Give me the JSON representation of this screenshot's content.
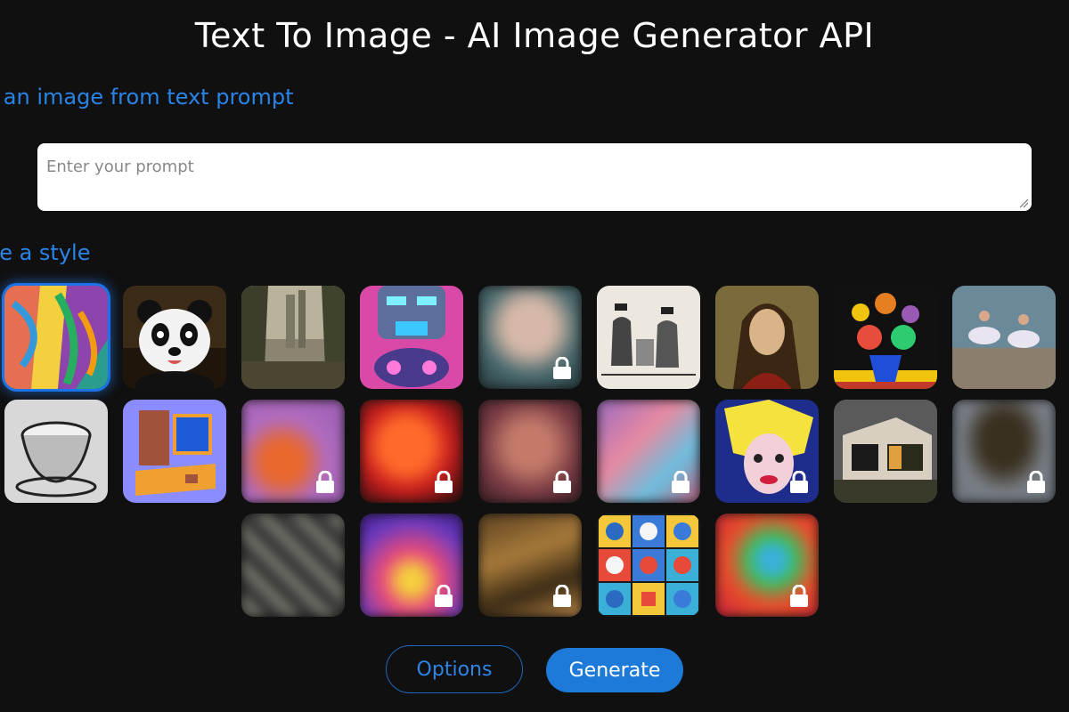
{
  "header": {
    "title": "Text To Image - AI Image Generator API",
    "subtitle": "te an image from text prompt"
  },
  "prompt": {
    "placeholder": "Enter your prompt",
    "value": ""
  },
  "styles": {
    "label": "ose a style",
    "tiles": [
      {
        "name": "abstract-painting",
        "locked": false,
        "selected": true
      },
      {
        "name": "panda",
        "locked": false
      },
      {
        "name": "forest-landscape",
        "locked": false
      },
      {
        "name": "robot",
        "locked": false
      },
      {
        "name": "portrait-woman",
        "locked": true
      },
      {
        "name": "sketch-men",
        "locked": false
      },
      {
        "name": "renaissance-portrait",
        "locked": false
      },
      {
        "name": "flower-vase",
        "locked": false
      },
      {
        "name": "ballet-dancers",
        "locked": false
      },
      {
        "name": "engraved-cup",
        "locked": false
      },
      {
        "name": "isometric-computer",
        "locked": false
      },
      {
        "name": "fox",
        "locked": true
      },
      {
        "name": "red-figure",
        "locked": true
      },
      {
        "name": "woman-statue",
        "locked": true
      },
      {
        "name": "pastel-sky",
        "locked": true
      },
      {
        "name": "pop-art-portrait",
        "locked": true
      },
      {
        "name": "modern-house",
        "locked": false
      },
      {
        "name": "dark-cloud",
        "locked": true
      },
      {
        "name": "gray-texture",
        "locked": false
      },
      {
        "name": "rabbit-neon",
        "locked": true
      },
      {
        "name": "brown-abstract",
        "locked": true
      },
      {
        "name": "crypto-icons",
        "locked": false
      },
      {
        "name": "dragon-rainbow",
        "locked": true
      }
    ]
  },
  "buttons": {
    "options": "Options",
    "generate": "Generate"
  },
  "colors": {
    "accent": "#1e7ad9",
    "background": "#101010",
    "link": "#2a84e8"
  },
  "icons": {
    "lock": "lock-icon"
  }
}
